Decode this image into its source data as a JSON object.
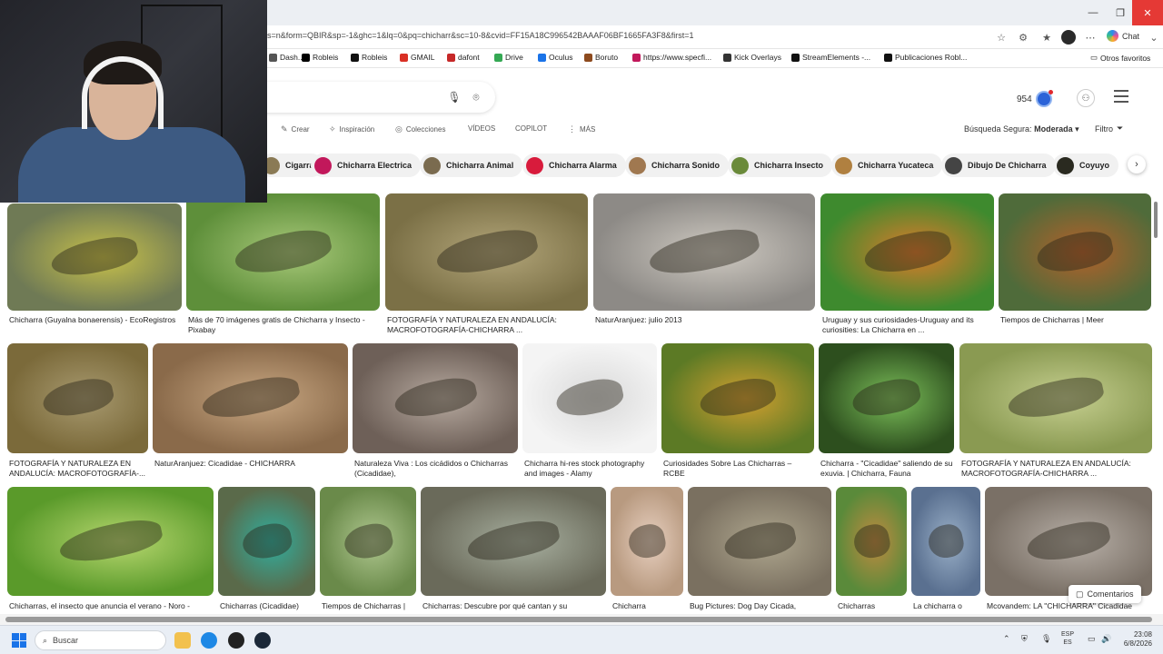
{
  "browser": {
    "url": "s=n&form=QBIR&sp=-1&ghc=1&lq=0&pq=chicharr&sc=10-8&cvid=FF15A18C996542BAAAF06BF1665FA3F8&first=1",
    "chat_label": "Chat",
    "window": {
      "min": "—",
      "max": "❐",
      "close": "✕"
    },
    "bookmarks": [
      {
        "label": "Dash...",
        "color": "#555555"
      },
      {
        "label": "Robleis",
        "color": "#000000"
      },
      {
        "label": "Robleis",
        "color": "#111111"
      },
      {
        "label": "GMAIL",
        "color": "#d93025"
      },
      {
        "label": "dafont",
        "color": "#c62828"
      },
      {
        "label": "Drive",
        "color": "#34a853"
      },
      {
        "label": "Oculus",
        "color": "#1a73e8"
      },
      {
        "label": "Boruto",
        "color": "#8d4a1e"
      },
      {
        "label": "https://www.specfi...",
        "color": "#c2185b"
      },
      {
        "label": "Kick Overlays",
        "color": "#333333"
      },
      {
        "label": "StreamElements -...",
        "color": "#111111"
      },
      {
        "label": "Publicaciones Robl...",
        "color": "#111111"
      }
    ],
    "other_favorites": "Otros favoritos"
  },
  "header": {
    "rewards_points": "954",
    "filters": {
      "crear": "Crear",
      "inspiracion": "Inspiración",
      "colecciones": "Colecciones",
      "videos": "VÍDEOS",
      "copilot": "COPILOT",
      "mas": "MÁS"
    },
    "safe_search_label": "Búsqueda Segura:",
    "safe_search_value": "Moderada",
    "filter_label": "Filtro"
  },
  "chips": [
    {
      "label": "Cigarra",
      "color": "#8a7a55"
    },
    {
      "label": "Chicharra Electrica",
      "color": "#c2185b"
    },
    {
      "label": "Chicharra Animal",
      "color": "#7a6b4f"
    },
    {
      "label": "Chicharra Alarma",
      "color": "#d81b3c"
    },
    {
      "label": "Chicharra Sonido",
      "color": "#a07850"
    },
    {
      "label": "Chicharra Insecto",
      "color": "#6a8a3a"
    },
    {
      "label": "Chicharra Yucateca",
      "color": "#b08040"
    },
    {
      "label": "Dibujo De Chicharra",
      "color": "#444444"
    },
    {
      "label": "Coyuyo",
      "color": "#2a2a20"
    }
  ],
  "results": [
    {
      "caption": "Chicharra (Guyalna bonaerensis) - EcoRegistros",
      "c1": "#6f7a55",
      "c2": "#c9c24a"
    },
    {
      "caption": "Más de 70 imágenes gratis de Chicharra y Insecto - Pixabay",
      "c1": "#5e8f3a",
      "c2": "#a9c97a"
    },
    {
      "caption": "FOTOGRAFÍA Y NATURALEZA EN ANDALUCÍA: MACROFOTOGRAFÍA-CHICHARRA ...",
      "c1": "#7b7046",
      "c2": "#b3a67a"
    },
    {
      "caption": "NaturAranjuez: julio 2013",
      "c1": "#8d8a86",
      "c2": "#cfcac2"
    },
    {
      "caption": "Uruguay y sus curiosidades-Uruguay and its curiosities: La Chicharra en ...",
      "c1": "#3e8a2e",
      "c2": "#e07a2a"
    },
    {
      "caption": "Tiempos de Chicharras | Meer",
      "c1": "#4f6b3a",
      "c2": "#b5602a"
    },
    {
      "caption": "FOTOGRAFÍA Y NATURALEZA EN ANDALUCÍA: MACROFOTOGRAFÍA-...",
      "c1": "#7b6a3a",
      "c2": "#a89a70"
    },
    {
      "caption": "NaturAranjuez: Cicadidae - CHICHARRA",
      "c1": "#8a6a4a",
      "c2": "#c9a883"
    },
    {
      "caption": "Naturaleza Viva : Los cicádidos o Chicharras (Cicadidae),",
      "c1": "#6e6058",
      "c2": "#b7aaa0"
    },
    {
      "caption": "Chicharra hi-res stock photography and images - Alamy",
      "c1": "#f4f4f4",
      "c2": "#d9d9d9"
    },
    {
      "caption": "Curiosidades Sobre Las Chicharras – RCBE",
      "c1": "#5c7a25",
      "c2": "#d4a030"
    },
    {
      "caption": "Chicharra - \"Cicadidae\" saliendo de su exuvia. | Chicharra, Fauna",
      "c1": "#2d4f1e",
      "c2": "#7cbf5a"
    },
    {
      "caption": "FOTOGRAFÍA Y NATURALEZA EN ANDALUCÍA: MACROFOTOGRAFÍA-CHICHARRA ...",
      "c1": "#8a9a52",
      "c2": "#c6cf90"
    },
    {
      "caption": "Chicharras, el insecto que anuncia el verano - Noro -",
      "c1": "#5a9a2a",
      "c2": "#b8d870"
    },
    {
      "caption": "Chicharras (Cicadidae)",
      "c1": "#5a6a4a",
      "c2": "#2fb0a0"
    },
    {
      "caption": "Tiempos de Chicharras |",
      "c1": "#6a8a4a",
      "c2": "#b0c890"
    },
    {
      "caption": "Chicharras: Descubre por qué cantan y su",
      "c1": "#6a6a5a",
      "c2": "#a8b0a0"
    },
    {
      "caption": "Chicharra",
      "c1": "#b89a80",
      "c2": "#e8d0c0"
    },
    {
      "caption": "Bug Pictures: Dog Day Cicada,",
      "c1": "#7a7060",
      "c2": "#b0a890"
    },
    {
      "caption": "Chicharras",
      "c1": "#5a8a3a",
      "c2": "#c08a40"
    },
    {
      "caption": "La chicharra o",
      "c1": "#5a7090",
      "c2": "#9ab0c8"
    },
    {
      "caption": "Mcovandem: LA \"CHICHARRA\" Cicadidae",
      "c1": "#7a7066",
      "c2": "#b8b0a8"
    }
  ],
  "comments_label": "Comentarios",
  "taskbar": {
    "search_placeholder": "Buscar",
    "lang_top": "ESP",
    "lang_bottom": "ES",
    "time": "23:08",
    "date": "6/8/2026"
  }
}
